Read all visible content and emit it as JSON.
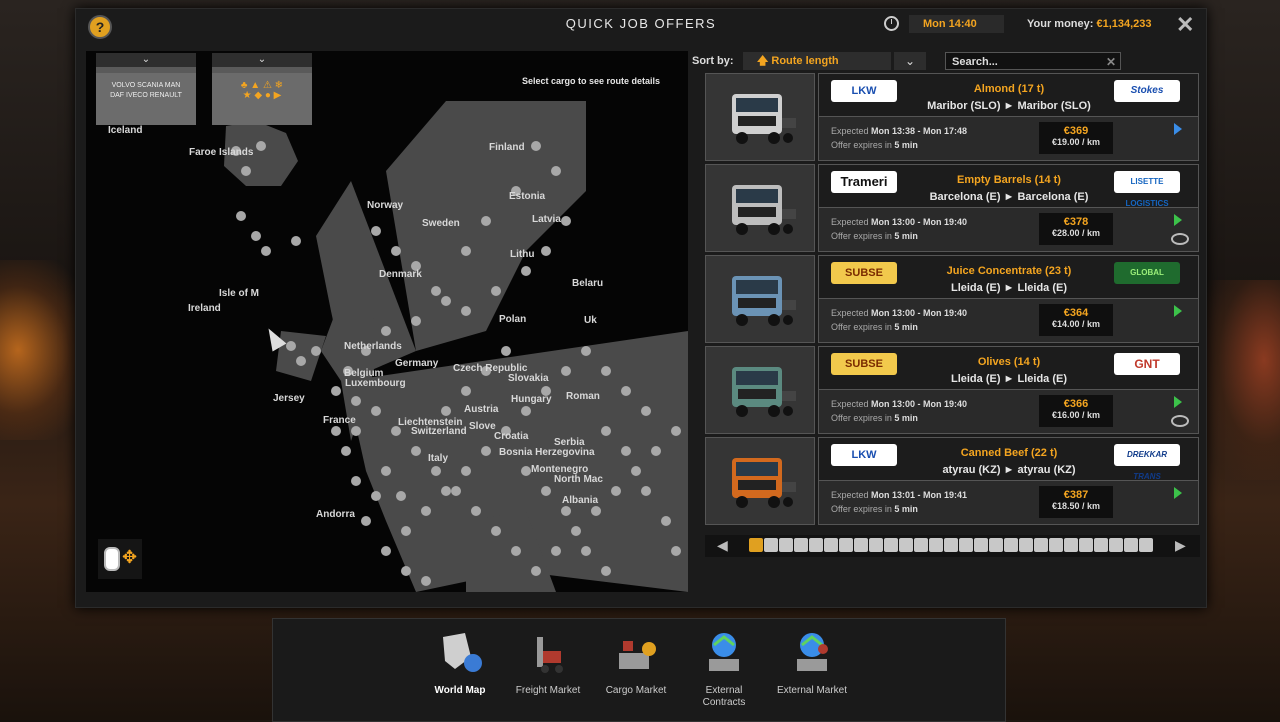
{
  "header": {
    "title": "QUICK JOB OFFERS",
    "time": "Mon 14:40",
    "money_label": "Your money:",
    "money_value": "€1,134,233",
    "colors": {
      "accent": "#f4a520",
      "background": "#1b1b1b"
    }
  },
  "map": {
    "hint": "Select cargo to see route details",
    "labels": [
      {
        "text": "Iceland"
      },
      {
        "text": "Faroe Islands"
      },
      {
        "text": "Finland"
      },
      {
        "text": "Estonia"
      },
      {
        "text": "Norway"
      },
      {
        "text": "Latvia"
      },
      {
        "text": "Sweden"
      },
      {
        "text": "Lithu"
      },
      {
        "text": "Isle of M"
      },
      {
        "text": "Ireland"
      },
      {
        "text": "Denmark"
      },
      {
        "text": "Belaru"
      },
      {
        "text": "Polan"
      },
      {
        "text": "Uk"
      },
      {
        "text": "Netherlands"
      },
      {
        "text": "Germany"
      },
      {
        "text": "Belgium"
      },
      {
        "text": "Luxembourg"
      },
      {
        "text": "Czech Republic"
      },
      {
        "text": "Slovakia"
      },
      {
        "text": "Hungary"
      },
      {
        "text": "Roman"
      },
      {
        "text": "Jersey"
      },
      {
        "text": "France"
      },
      {
        "text": "Austria"
      },
      {
        "text": "Liechtenstein"
      },
      {
        "text": "Switzerland"
      },
      {
        "text": "Slove"
      },
      {
        "text": "Croatia"
      },
      {
        "text": "Serbia"
      },
      {
        "text": "Bosnia Herzegovina"
      },
      {
        "text": "Italy"
      },
      {
        "text": "Montenegro"
      },
      {
        "text": "North Mac"
      },
      {
        "text": "Albania"
      },
      {
        "text": "Andorra"
      }
    ]
  },
  "sort": {
    "label": "Sort by:",
    "value": "Route length",
    "search_placeholder": "Search..."
  },
  "offers": [
    {
      "cargo": "Almond (17 t)",
      "route": "Maribor (SLO) ► Maribor (SLO)",
      "company": "LKW",
      "target": "Stokes",
      "expected_label": "Expected",
      "expected": "Mon 13:38 - Mon 17:48",
      "expires_label": "Offer expires in",
      "expires": "5 min",
      "price": "€369",
      "per_km": "€19.00 / km",
      "truck_color": "#cfcfcf",
      "icon": "fast-forward-icon"
    },
    {
      "cargo": "Empty Barrels (14 t)",
      "route": "Barcelona (E) ► Barcelona (E)",
      "company": "Trameri",
      "target": "LISETTE LOGISTICS",
      "expected_label": "Expected",
      "expected": "Mon 13:00 - Mon 19:40",
      "expires_label": "Offer expires in",
      "expires": "5 min",
      "price": "€378",
      "per_km": "€28.00 / km",
      "truck_color": "#bdbdbd",
      "icon": "play-icon"
    },
    {
      "cargo": "Juice Concentrate (23 t)",
      "route": "Lleida (E) ► Lleida (E)",
      "company": "SUBSE",
      "target": "GLOBAL",
      "expected_label": "Expected",
      "expected": "Mon 13:00 - Mon 19:40",
      "expires_label": "Offer expires in",
      "expires": "5 min",
      "price": "€364",
      "per_km": "€14.00 / km",
      "truck_color": "#6b93b5",
      "icon": "play-icon"
    },
    {
      "cargo": "Olives (14 t)",
      "route": "Lleida (E) ► Lleida (E)",
      "company": "SUBSE",
      "target": "GNT",
      "expected_label": "Expected",
      "expected": "Mon 13:00 - Mon 19:40",
      "expires_label": "Offer expires in",
      "expires": "5 min",
      "price": "€366",
      "per_km": "€16.00 / km",
      "truck_color": "#5b8a80",
      "icon": "play-icon"
    },
    {
      "cargo": "Canned Beef (22 t)",
      "route": "atyrau (KZ) ► atyrau (KZ)",
      "company": "LKW",
      "target": "DREKKAR TRANS",
      "expected_label": "Expected",
      "expected": "Mon 13:01 - Mon 19:41",
      "expires_label": "Offer expires in",
      "expires": "5 min",
      "price": "€387",
      "per_km": "€18.50 / km",
      "truck_color": "#d2691e",
      "icon": "play-icon"
    }
  ],
  "pager": {
    "active_page": 1,
    "page_count": 27
  },
  "bottom_nav": [
    {
      "label": "World Map",
      "active": true,
      "icon": "world-map-icon"
    },
    {
      "label": "Freight Market",
      "active": false,
      "icon": "forklift-icon"
    },
    {
      "label": "Cargo Market",
      "active": false,
      "icon": "cargo-market-icon"
    },
    {
      "label": "External Contracts",
      "active": false,
      "icon": "external-contracts-icon"
    },
    {
      "label": "External Market",
      "active": false,
      "icon": "external-market-icon"
    }
  ]
}
